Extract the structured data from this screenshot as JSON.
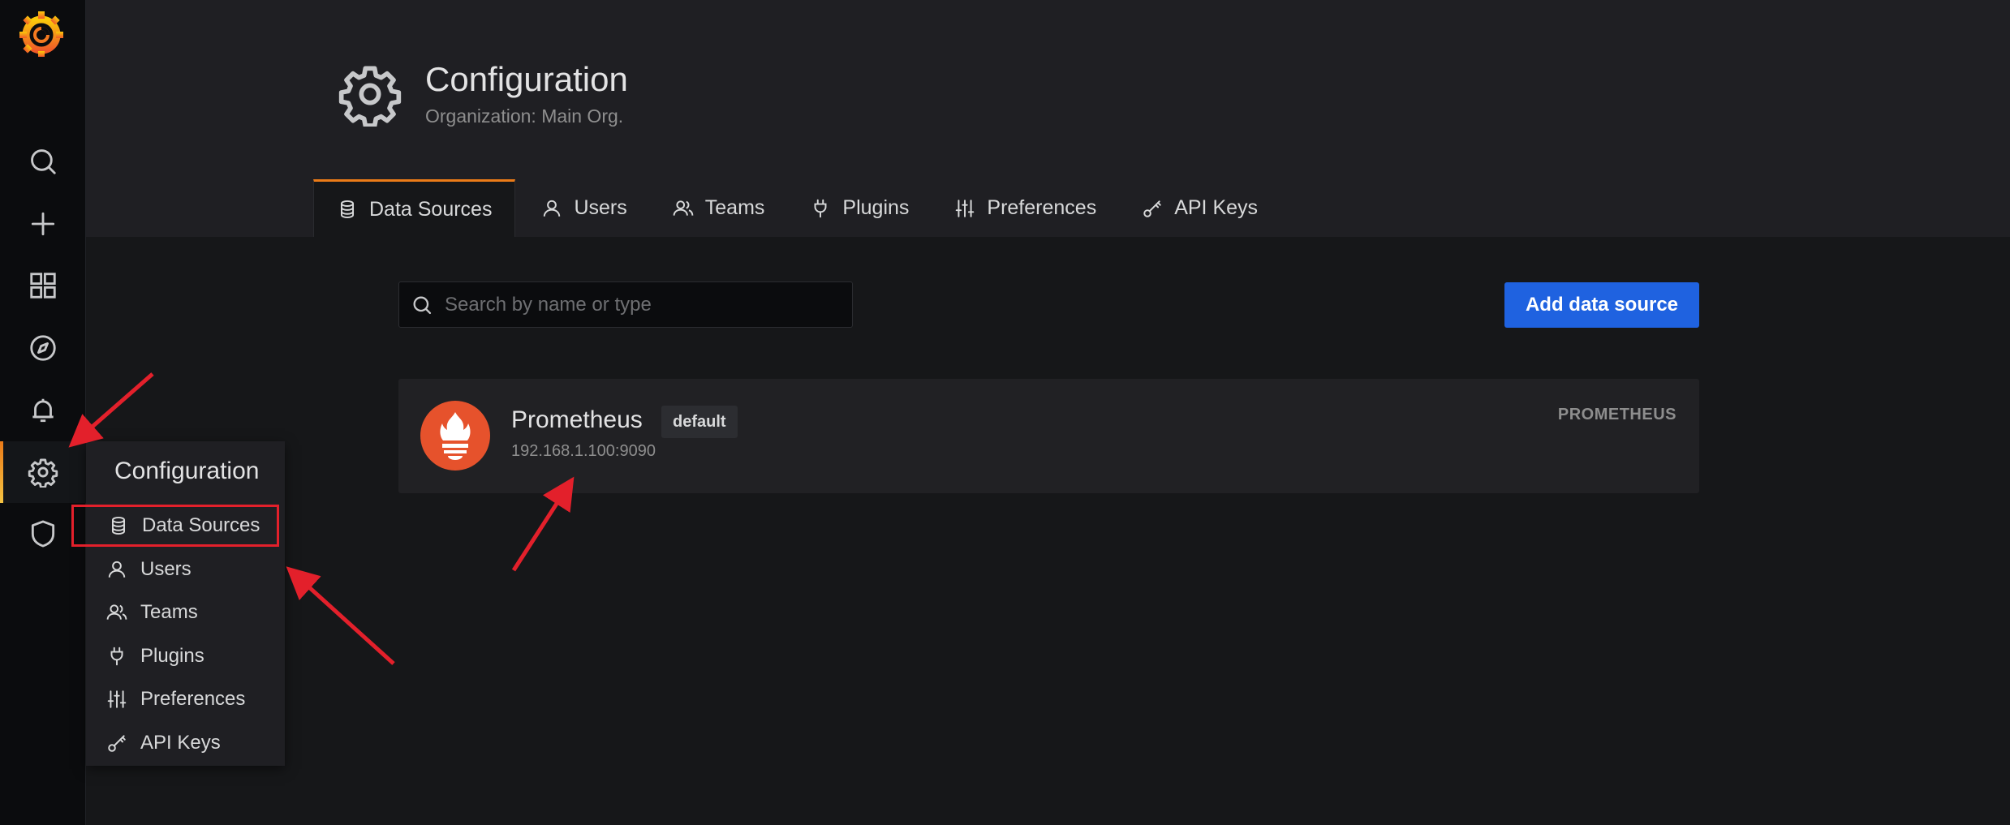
{
  "sidebar": {
    "items": [
      {
        "icon": "search-icon"
      },
      {
        "icon": "plus-icon"
      },
      {
        "icon": "dashboards-icon"
      },
      {
        "icon": "explore-icon"
      },
      {
        "icon": "bell-icon"
      },
      {
        "icon": "gear-icon",
        "active": true
      },
      {
        "icon": "shield-icon"
      }
    ]
  },
  "header": {
    "title": "Configuration",
    "subtitle": "Organization: Main Org.",
    "tabs": [
      {
        "label": "Data Sources",
        "icon": "database-icon",
        "active": true
      },
      {
        "label": "Users",
        "icon": "user-icon"
      },
      {
        "label": "Teams",
        "icon": "users-icon"
      },
      {
        "label": "Plugins",
        "icon": "plug-icon"
      },
      {
        "label": "Preferences",
        "icon": "sliders-icon"
      },
      {
        "label": "API Keys",
        "icon": "key-icon"
      }
    ]
  },
  "search": {
    "placeholder": "Search by name or type",
    "value": ""
  },
  "add_button": {
    "label": "Add data source"
  },
  "datasources": [
    {
      "name": "Prometheus",
      "badge": "default",
      "url": "192.168.1.100:9090",
      "type": "PROMETHEUS"
    }
  ],
  "flyout": {
    "title": "Configuration",
    "items": [
      {
        "label": "Data Sources",
        "icon": "database-icon"
      },
      {
        "label": "Users",
        "icon": "user-icon"
      },
      {
        "label": "Teams",
        "icon": "users-icon"
      },
      {
        "label": "Plugins",
        "icon": "plug-icon"
      },
      {
        "label": "Preferences",
        "icon": "sliders-icon"
      },
      {
        "label": "API Keys",
        "icon": "key-icon"
      }
    ]
  },
  "colors": {
    "accent": "#eb7b18",
    "primary_button": "#1f62e0",
    "annotation": "#e3202b"
  }
}
